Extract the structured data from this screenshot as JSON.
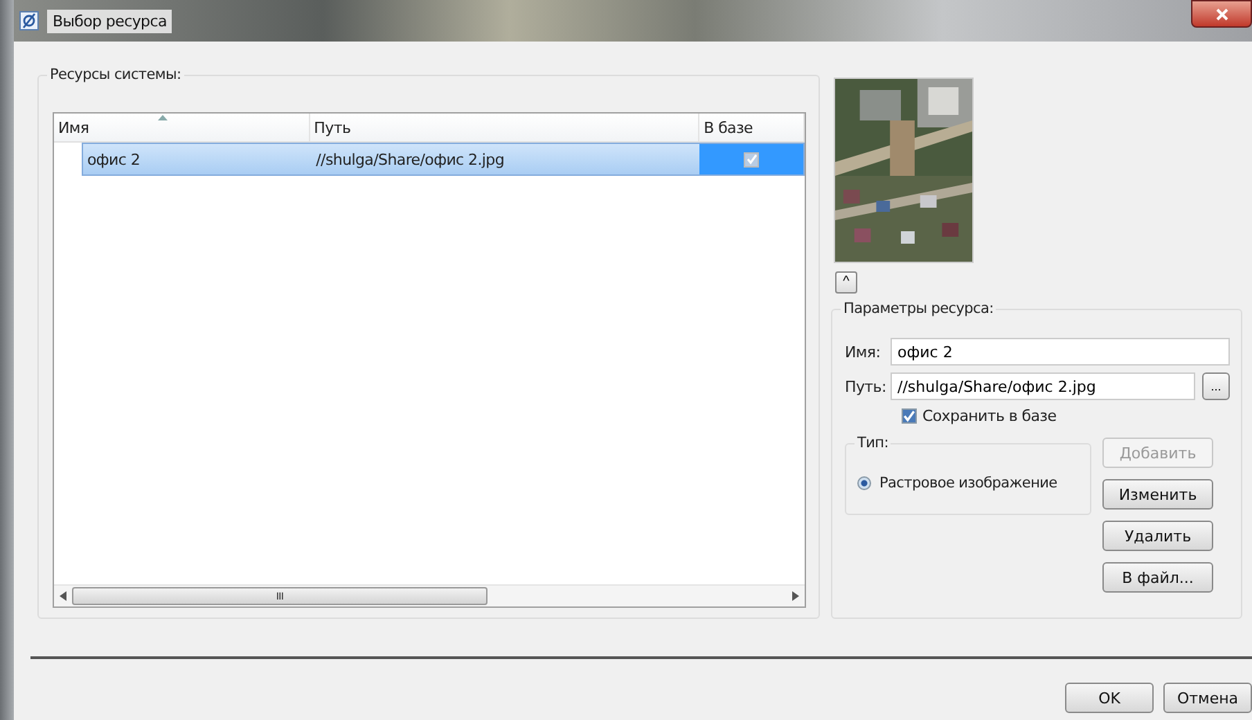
{
  "window": {
    "title": "Выбор ресурса"
  },
  "resources": {
    "title": "Ресурсы системы:",
    "columns": [
      {
        "label": "Имя",
        "sorted": true
      },
      {
        "label": "Путь",
        "sorted": false
      },
      {
        "label": "В базе",
        "sorted": false
      }
    ],
    "rows": [
      {
        "name": "офис 2",
        "path": "//shulga/Share/офис 2.jpg",
        "in_base": true,
        "selected": true
      }
    ],
    "scroll_grip": "III"
  },
  "preview": {
    "kind": "picture",
    "collapse_label": "^"
  },
  "params": {
    "title": "Параметры ресурса:",
    "name_label": "Имя:",
    "name_value": "офис 2",
    "path_label": "Путь:",
    "path_value": "//shulga/Share/офис 2.jpg",
    "browse_label": "...",
    "save": {
      "label": "Сохранить в базе",
      "checked": true
    },
    "type": {
      "title": "Тип:",
      "options": [
        {
          "label": "Растровое изображение",
          "selected": true
        }
      ]
    },
    "buttons": [
      {
        "label": "Добавить",
        "disabled": true
      },
      {
        "label": "Изменить",
        "disabled": false
      },
      {
        "label": "Удалить",
        "disabled": false
      },
      {
        "label": "В файл...",
        "disabled": false
      }
    ]
  },
  "footer": {
    "buttons": [
      {
        "label": "OK"
      },
      {
        "label": "Отмена"
      }
    ]
  }
}
